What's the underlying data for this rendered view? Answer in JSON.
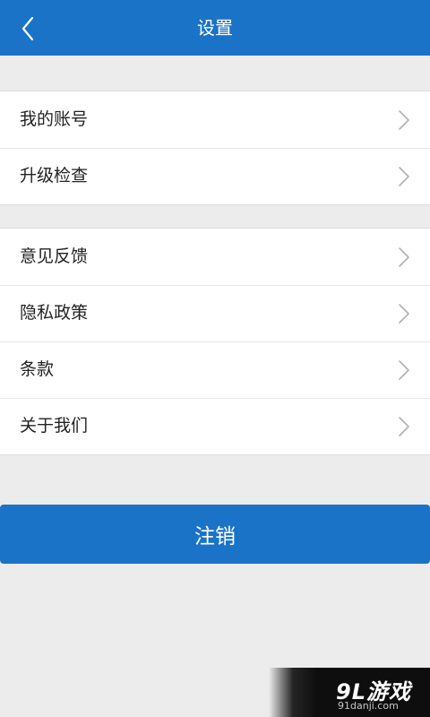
{
  "header": {
    "title": "设置",
    "back_icon": "chevron-left-icon"
  },
  "groups": [
    {
      "items": [
        {
          "label": "我的账号"
        },
        {
          "label": "升级检查"
        }
      ]
    },
    {
      "items": [
        {
          "label": "意见反馈"
        },
        {
          "label": "隐私政策"
        },
        {
          "label": "条款"
        },
        {
          "label": "关于我们"
        }
      ]
    }
  ],
  "logout_label": "注销",
  "watermark": {
    "logo": "9L游戏",
    "domain": "91danji.com"
  },
  "colors": {
    "primary": "#1a73c6",
    "background": "#ececec",
    "row_text": "#222222",
    "chevron": "#b0b0b0"
  }
}
